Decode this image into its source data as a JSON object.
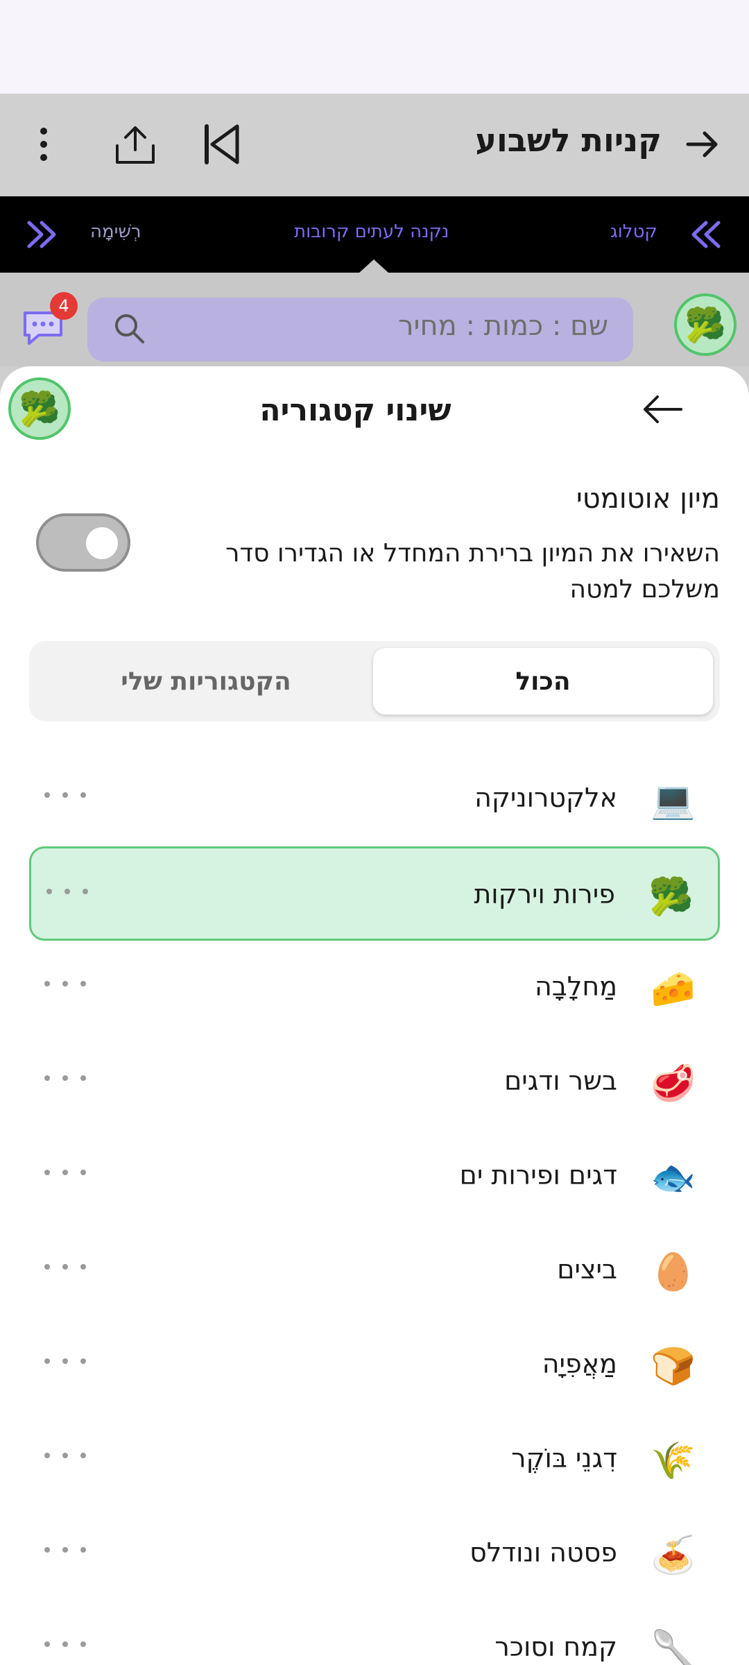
{
  "header": {
    "title": "קניות לשבוע",
    "icons": [
      "back-arrow-icon",
      "skip-previous-icon",
      "share-icon",
      "more-vertical-icon"
    ]
  },
  "tabs": {
    "left": "רְשִׁימָה",
    "center": "נקנה לעתים קרובות",
    "right": "קטלוג"
  },
  "search": {
    "placeholder": "שם : כמות : מחיר",
    "badge_count": "4",
    "avatar_emoji": "🥦"
  },
  "sheet": {
    "title": "שינוי קטגוריה",
    "avatar_emoji": "🥦",
    "auto_sort_title": "מיון אוטומטי",
    "auto_sort_desc": "השאירו את המיון ברירת המחדל או הגדירו סדר משלכם למטה",
    "auto_sort_enabled": false,
    "segments": {
      "all": "הכול",
      "mine": "הקטגוריות שלי"
    },
    "categories": [
      {
        "emoji": "💻",
        "name": "אלקטרוניקה",
        "selected": false
      },
      {
        "emoji": "🥦",
        "name": "פירות וירקות",
        "selected": true
      },
      {
        "emoji": "🧀",
        "name": "מַחלָבָה",
        "selected": false
      },
      {
        "emoji": "🥩",
        "name": "בשר ודגים",
        "selected": false
      },
      {
        "emoji": "🐟",
        "name": "דגים ופירות ים",
        "selected": false
      },
      {
        "emoji": "🥚",
        "name": "ביצים",
        "selected": false
      },
      {
        "emoji": "🍞",
        "name": "מַאֲפִיָה",
        "selected": false
      },
      {
        "emoji": "🌾",
        "name": "דִגנֵי בּוֹקֶר",
        "selected": false
      },
      {
        "emoji": "🍝",
        "name": "פסטה ונודלס",
        "selected": false
      },
      {
        "emoji": "🥄",
        "name": "קמח וסוכר",
        "selected": false
      }
    ]
  },
  "colors": {
    "accent": "#7b6cf0",
    "selected_bg": "#d6f2e0",
    "selected_border": "#5fc97a",
    "badge": "#e53935"
  }
}
